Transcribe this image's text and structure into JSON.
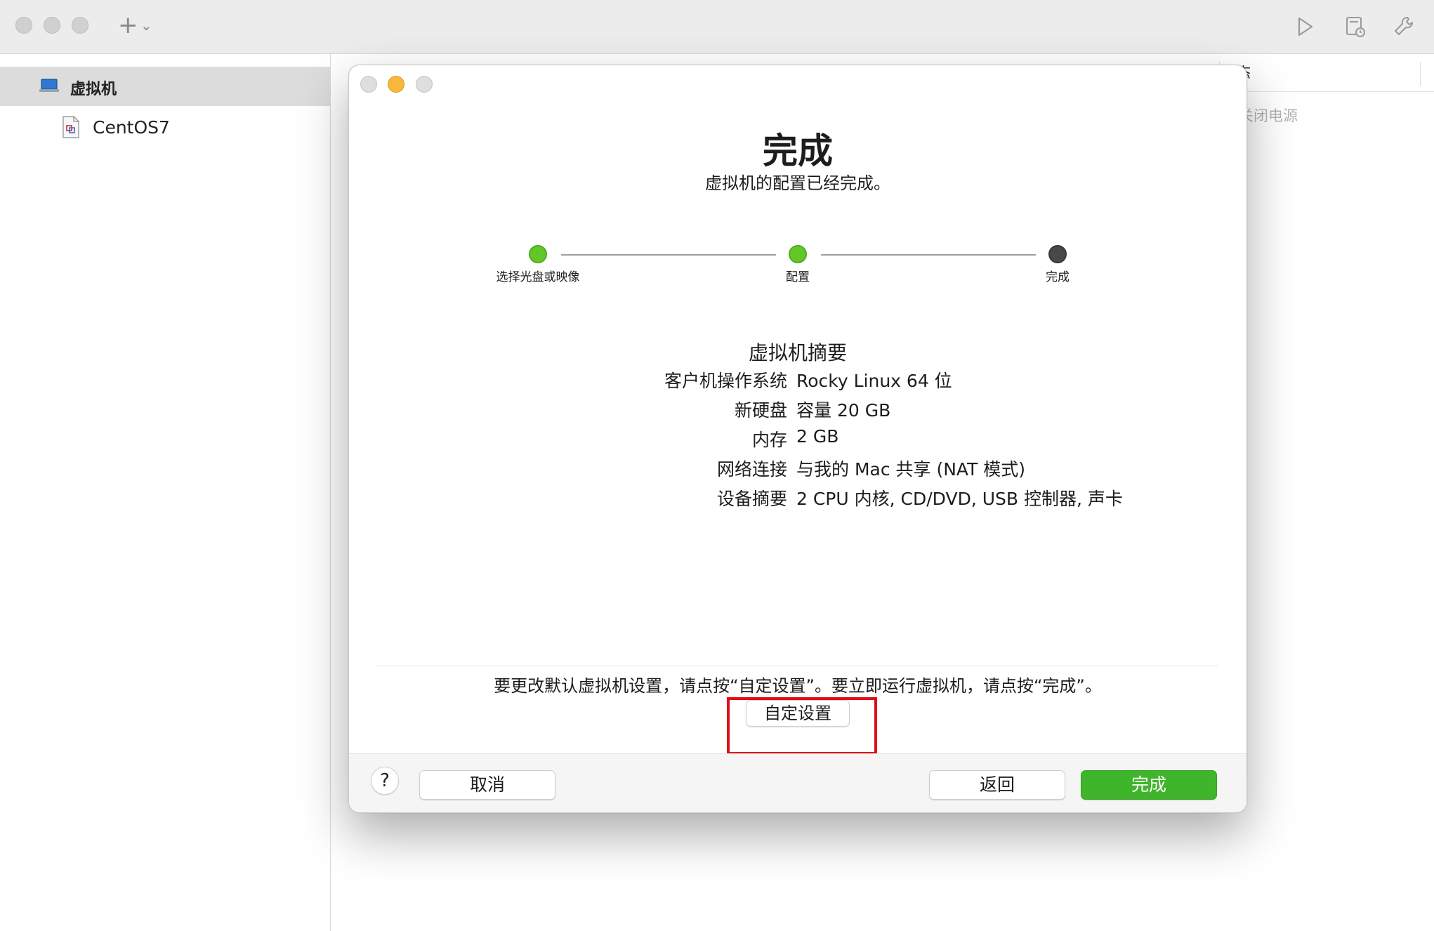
{
  "toolbar": {
    "add_symbol": "+",
    "add_chevron": "⌄"
  },
  "sidebar": {
    "header_label": "虚拟机",
    "items": [
      {
        "label": "CentOS7"
      }
    ]
  },
  "list": {
    "column_header": "态",
    "status_value": "关闭电源"
  },
  "dialog": {
    "title": "完成",
    "subtitle": "虚拟机的配置已经完成。",
    "steps": [
      {
        "label": "选择光盘或映像",
        "state": "done"
      },
      {
        "label": "配置",
        "state": "done"
      },
      {
        "label": "完成",
        "state": "current"
      }
    ],
    "summary": {
      "title": "虚拟机摘要",
      "rows": [
        {
          "key": "客户机操作系统",
          "value": "Rocky Linux 64 位"
        },
        {
          "key": "新硬盘",
          "value": "容量 20 GB"
        },
        {
          "key": "内存",
          "value": "2 GB"
        },
        {
          "key": "网络连接",
          "value": "与我的 Mac 共享 (NAT 模式)"
        },
        {
          "key": "设备摘要",
          "value": "2 CPU 内核, CD/DVD, USB 控制器, 声卡"
        }
      ]
    },
    "hint": "要更改默认虚拟机设置，请点按“自定设置”。要立即运行虚拟机，请点按“完成”。",
    "customize_label": "自定设置",
    "help_label": "?",
    "cancel_label": "取消",
    "back_label": "返回",
    "finish_label": "完成"
  },
  "colors": {
    "step_done": "#63c72a",
    "step_current": "#484848",
    "primary_button": "#3fb52b",
    "highlight_box": "#e00c16"
  }
}
